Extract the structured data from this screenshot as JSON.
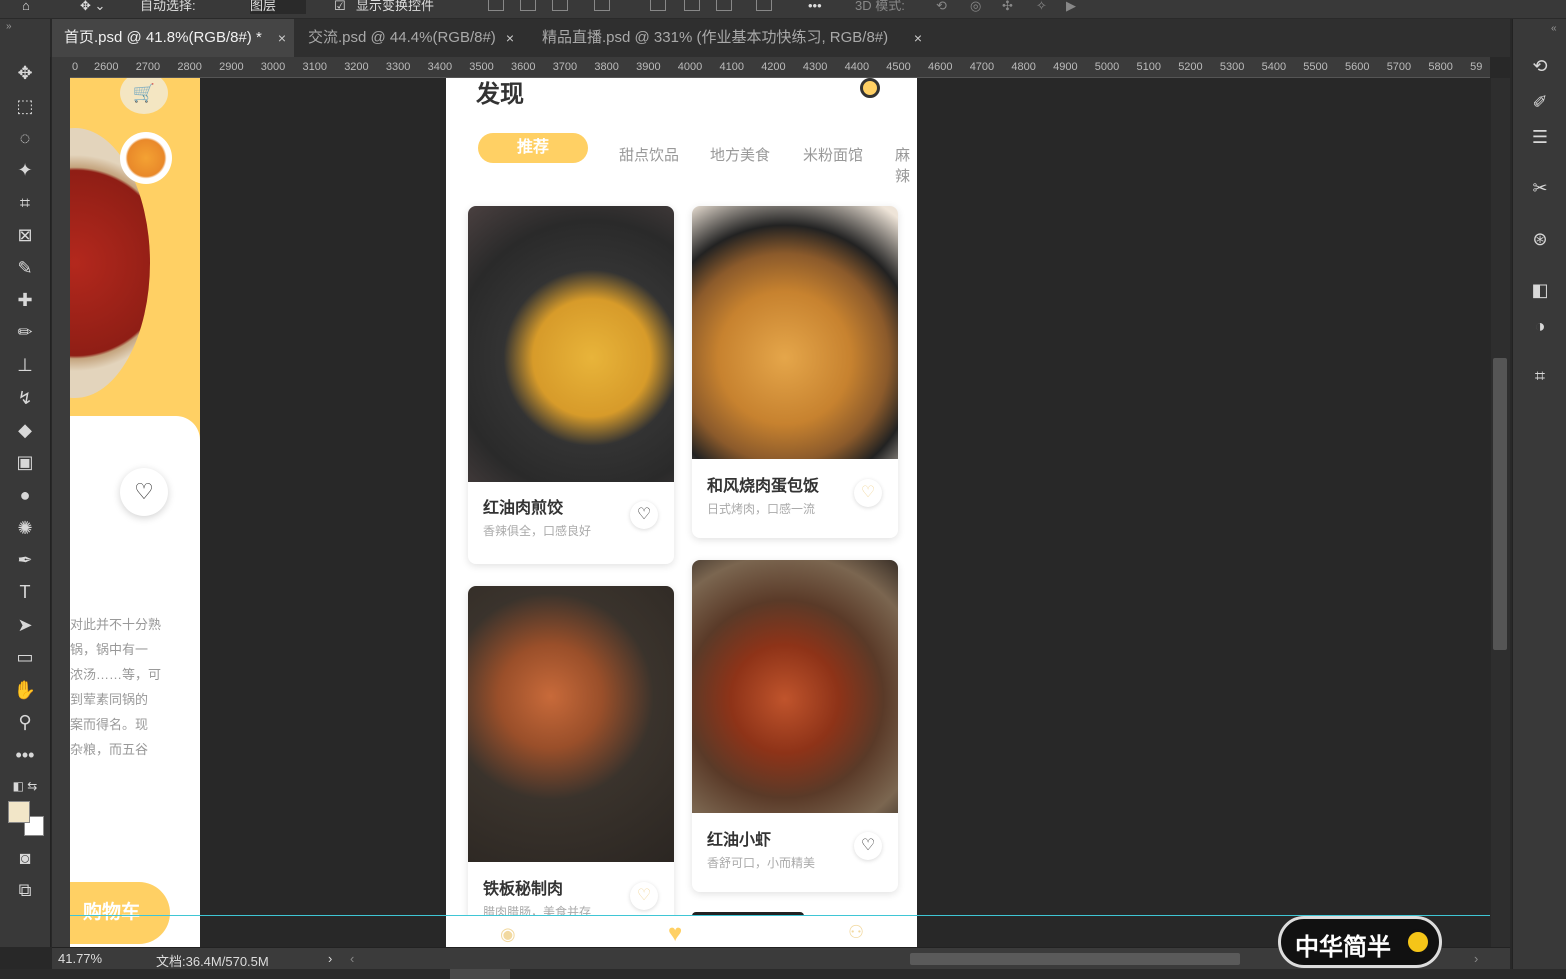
{
  "optionsbar": {
    "auto_select_label": "自动选择:",
    "layer_dropdown": "图层",
    "show_transform_label": "显示变换控件",
    "mode_3d_label": "3D 模式:"
  },
  "tabs": [
    {
      "label": "首页.psd @ 41.8%(RGB/8#) *",
      "close": "×"
    },
    {
      "label": "交流.psd @ 44.4%(RGB/8#)",
      "close": "×"
    },
    {
      "label": "精品直播.psd @ 331% (作业基本功快练习, RGB/8#)",
      "close": "×"
    }
  ],
  "ruler": {
    "ticks": [
      "0",
      "2600",
      "2700",
      "2800",
      "2900",
      "3000",
      "3100",
      "3200",
      "3300",
      "3400",
      "3500",
      "3600",
      "3700",
      "3800",
      "3900",
      "4000",
      "4100",
      "4200",
      "4300",
      "4400",
      "4500",
      "4600",
      "4700",
      "4800",
      "4900",
      "5000",
      "5100",
      "5200",
      "5300",
      "5400",
      "5500",
      "5600",
      "5700",
      "5800",
      "59"
    ]
  },
  "artboard": {
    "title": "发现",
    "categories": [
      "推荐",
      "甜点饮品",
      "地方美食",
      "米粉面馆",
      "麻辣"
    ],
    "cards": [
      {
        "title": "红油肉煎饺",
        "subtitle": "香辣俱全，口感良好"
      },
      {
        "title": "和风烧肉蛋包饭",
        "subtitle": "日式烤肉，口感一流"
      },
      {
        "title": "铁板秘制肉",
        "subtitle": "腊肉腊肠，美食并存"
      },
      {
        "title": "红油小虾",
        "subtitle": "香舒可口，小而精美"
      }
    ]
  },
  "left_artboard": {
    "paragraph": [
      "对此并不十分熟",
      "锅，锅中有一",
      "浓汤……等，可",
      "到荤素同锅的",
      "案而得名。现",
      "杂粮，而五谷"
    ],
    "cart_button": "购物车"
  },
  "statusbar": {
    "zoom": "41.77%",
    "doc_info": "文档:36.4M/570.5M"
  },
  "watermark": "中华简半",
  "colors": {
    "accent": "#ffd064",
    "panel": "#393939",
    "canvas": "#282828",
    "guide": "#3fc6d5"
  }
}
